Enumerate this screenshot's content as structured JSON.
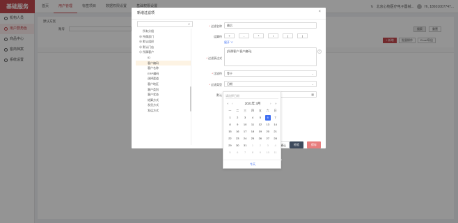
{
  "app": {
    "brand": "基础服务"
  },
  "nav": {
    "tabs": [
      "首页",
      "用户管理",
      "标签项目",
      "数据权限设置",
      "基础权限设置"
    ],
    "active_index": 1
  },
  "topright": {
    "company": "北京心物医疗电子器械...",
    "user": "Hi, 18601007747..."
  },
  "sidebar": {
    "items": [
      "机构人员",
      "用户群角色",
      "商品中心",
      "客商档案",
      "系统设置"
    ],
    "active_index": 1
  },
  "background": {
    "breadcrumb": "默认方案",
    "filter_label": "账号",
    "search_btn": "搜索",
    "reset_btn": "重置",
    "add_btn": "+ 新增",
    "batch_btn": "批量操作",
    "export_btn": "Excel导出"
  },
  "modal": {
    "title": "新增过滤项",
    "close": "×",
    "search_placeholder": "",
    "tree": [
      "所有分组",
      "所属部门",
      "默认组织",
      "默认门店",
      "所属客户",
      "ID",
      "客户编码",
      "客户名称",
      "ERP编码",
      "选择渠道",
      "客户地区",
      "客户类别",
      "客户状态",
      "结算方式",
      "发货方式",
      "发运方式"
    ],
    "tree_selected_index": 6,
    "form": {
      "name_label": "过滤名称",
      "name_value": "最后",
      "operator_label": "运算符",
      "operators": [
        "+",
        "-",
        "*",
        "/",
        "(",
        ")"
      ],
      "more_link": "展开 ∨",
      "expr_label": "过滤表达式",
      "expr_value": "[所属客户.客户编码]",
      "cond_label": "比较符",
      "cond_value": "等于",
      "type_label": "过滤类型",
      "type_value": "日期",
      "default_label": "默认",
      "date_placeholder": "请选择日期"
    },
    "footer": {
      "confirm": "确认",
      "save": "检验",
      "cancel": "保存"
    }
  },
  "calendar": {
    "placeholder": "请选择日期",
    "header": "2021年 3月",
    "nav_prev_year": "«",
    "nav_prev": "‹",
    "nav_next": "›",
    "nav_next_year": "»",
    "weekdays": [
      "一",
      "二",
      "三",
      "四",
      "五",
      "六",
      "日"
    ],
    "weeks": [
      [
        "1",
        "2",
        "3",
        "4",
        "5",
        "6",
        "7"
      ],
      [
        "8",
        "9",
        "10",
        "11",
        "12",
        "13",
        "14"
      ],
      [
        "15",
        "16",
        "17",
        "18",
        "19",
        "20",
        "21"
      ],
      [
        "22",
        "23",
        "24",
        "25",
        "26",
        "27",
        "28"
      ],
      [
        "29",
        "30",
        "31",
        "1",
        "2",
        "3",
        "4"
      ],
      [
        "5",
        "6",
        "7",
        "8",
        "9",
        "10",
        "11"
      ]
    ],
    "today": "6",
    "today_btn": "今天"
  },
  "colors": {
    "brand": "#c4494f",
    "accent": "#3d6df2"
  }
}
